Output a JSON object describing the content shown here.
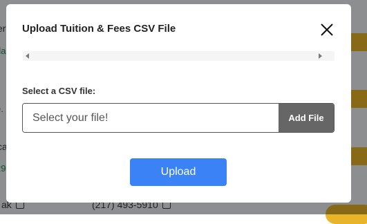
{
  "modal": {
    "title": "Upload Tuition & Fees CSV File",
    "field_label": "Select a CSV file:",
    "file_placeholder": "Select your file!",
    "add_file_label": "Add File",
    "upload_label": "Upload"
  },
  "background": {
    "phone_text": "(217) 493-5910",
    "name_fragment": "ak"
  },
  "colors": {
    "upload_button": "#3b82f6",
    "add_file_button": "#666666",
    "badge": "#e8b52a"
  }
}
